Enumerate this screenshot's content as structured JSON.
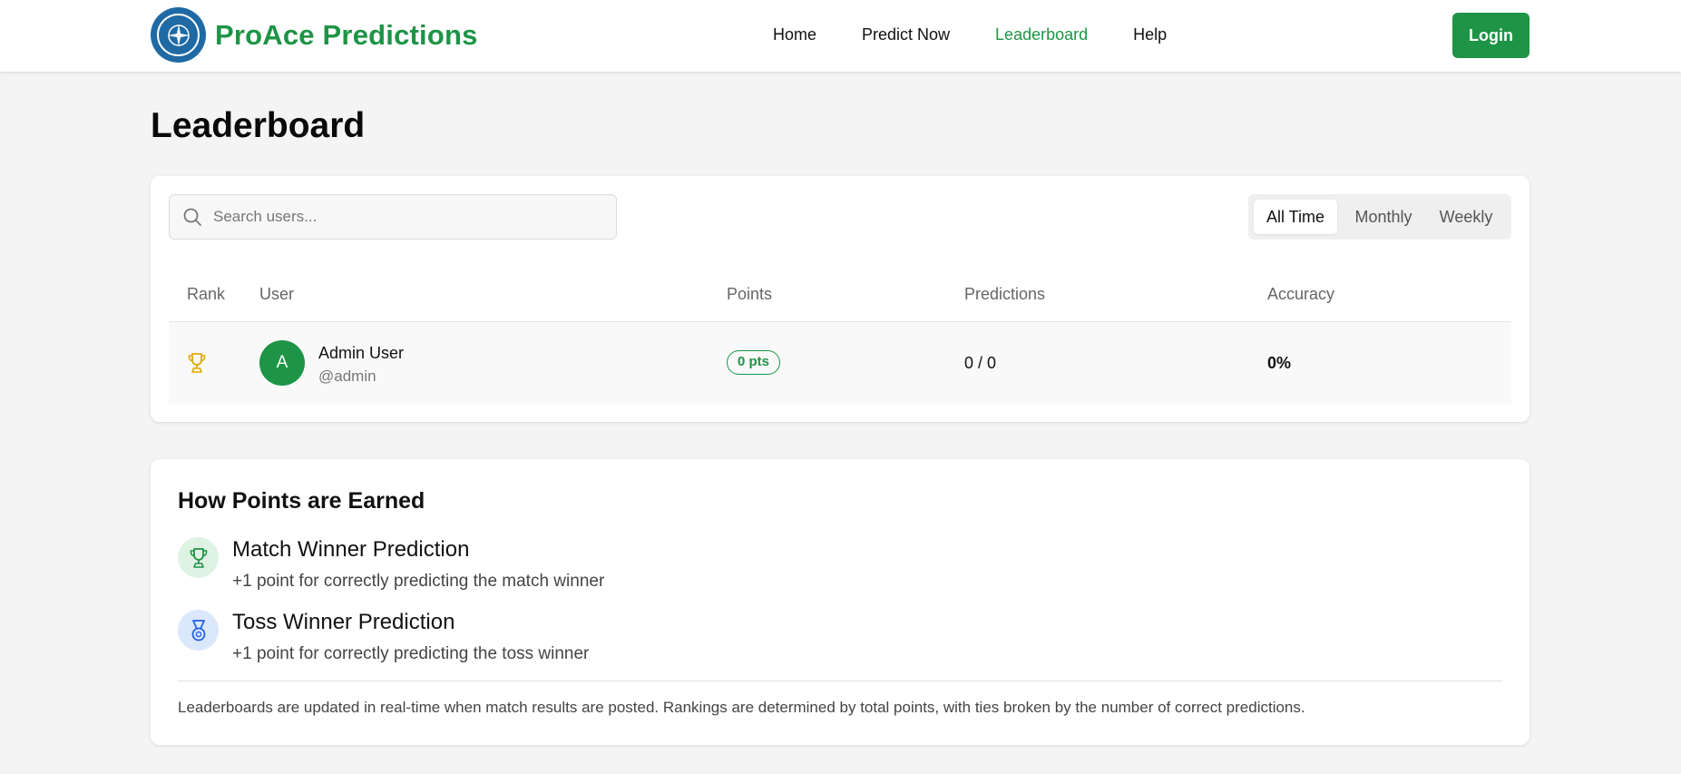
{
  "header": {
    "brand": "ProAce Predictions",
    "nav": [
      "Home",
      "Predict Now",
      "Leaderboard",
      "Help"
    ],
    "active_nav": "Leaderboard",
    "login_label": "Login"
  },
  "page": {
    "title": "Leaderboard"
  },
  "leaderboard": {
    "search_placeholder": "Search users...",
    "periods": [
      "All Time",
      "Monthly",
      "Weekly"
    ],
    "active_period": "All Time",
    "columns": [
      "Rank",
      "User",
      "Points",
      "Predictions",
      "Accuracy"
    ],
    "rows": [
      {
        "rank_icon": "trophy-icon",
        "avatar_letter": "A",
        "name": "Admin User",
        "handle": "@admin",
        "points": "0 pts",
        "predictions": "0 / 0",
        "accuracy": "0%"
      }
    ]
  },
  "points_info": {
    "title": "How Points are Earned",
    "rules": [
      {
        "icon": "trophy-icon",
        "title": "Match Winner Prediction",
        "desc": "+1 point for correctly predicting the match winner"
      },
      {
        "icon": "medal-icon",
        "title": "Toss Winner Prediction",
        "desc": "+1 point for correctly predicting the toss winner"
      }
    ],
    "note": "Leaderboards are updated in real-time when match results are posted. Rankings are determined by total points, with ties broken by the number of correct predictions."
  },
  "colors": {
    "brand_green": "#1e9446",
    "logo_blue": "#1f6aa5",
    "trophy_gold": "#e0a800",
    "medal_blue": "#2563eb"
  }
}
